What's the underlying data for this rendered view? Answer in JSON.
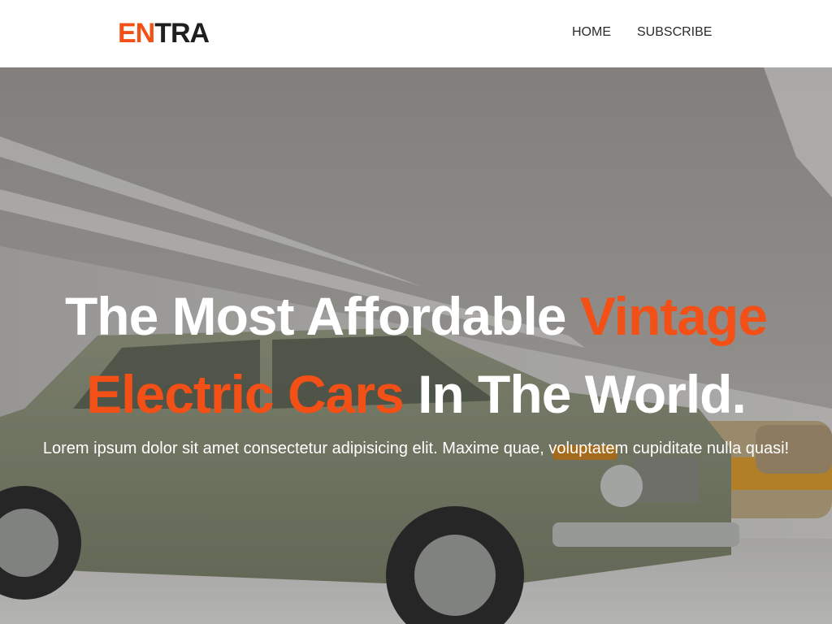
{
  "brand": {
    "accent": "EN",
    "rest": "TRA",
    "accent_color": "#f25016"
  },
  "nav": [
    {
      "label": "HOME"
    },
    {
      "label": "SUBSCRIBE"
    }
  ],
  "hero": {
    "headline_part1": "The Most Affordable ",
    "headline_highlight1": "Vintage",
    "headline_highlight2": "Electric Cars",
    "headline_part2": " In The World.",
    "subtext": "Lorem ipsum dolor sit amet consectetur adipisicing elit. Maxime quae, voluptatem cupiditate nulla quasi!",
    "background_image": "vintage-car-museum-photo"
  }
}
